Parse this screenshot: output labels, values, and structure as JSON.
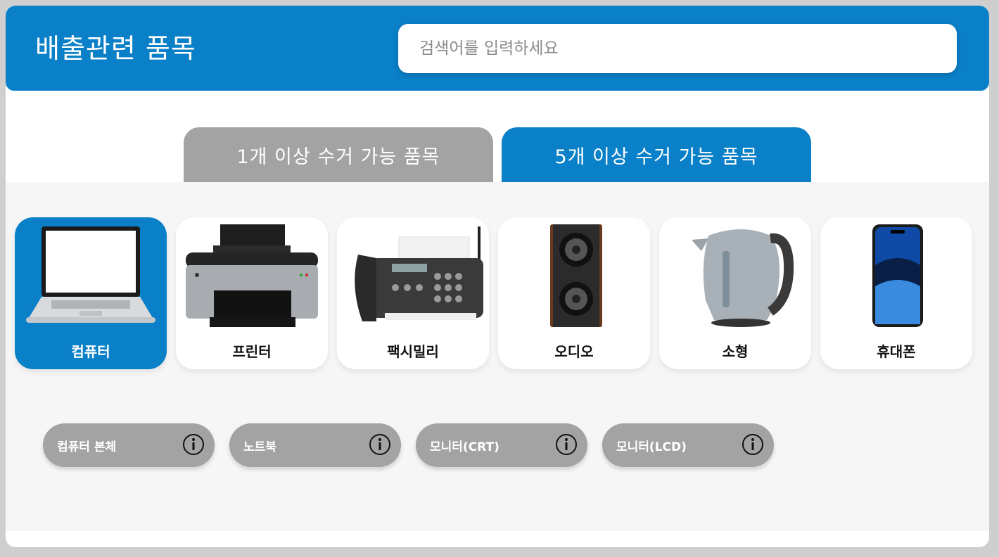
{
  "header": {
    "title": "배출관련 품목",
    "search_placeholder": "검색어를 입력하세요"
  },
  "tabs": [
    {
      "label": "1개 이상 수거 가능 품목",
      "active": false
    },
    {
      "label": "5개 이상 수거 가능 품목",
      "active": true
    }
  ],
  "categories": [
    {
      "label": "컴퓨터",
      "icon": "laptop-icon",
      "selected": true
    },
    {
      "label": "프린터",
      "icon": "printer-icon",
      "selected": false
    },
    {
      "label": "팩시밀리",
      "icon": "fax-icon",
      "selected": false
    },
    {
      "label": "오디오",
      "icon": "speaker-icon",
      "selected": false
    },
    {
      "label": "소형",
      "icon": "kettle-icon",
      "selected": false
    },
    {
      "label": "휴대폰",
      "icon": "phone-icon",
      "selected": false
    }
  ],
  "items": [
    {
      "label": "컴퓨터 본체",
      "icon": "info-icon"
    },
    {
      "label": "노트북",
      "icon": "info-icon"
    },
    {
      "label": "모니터(CRT)",
      "icon": "info-icon"
    },
    {
      "label": "모니터(LCD)",
      "icon": "info-icon"
    }
  ],
  "colors": {
    "primary": "#0a80c8",
    "inactive": "#a3a3a3",
    "panel": "#f6f6f6",
    "frame": "#cfcfcf"
  }
}
